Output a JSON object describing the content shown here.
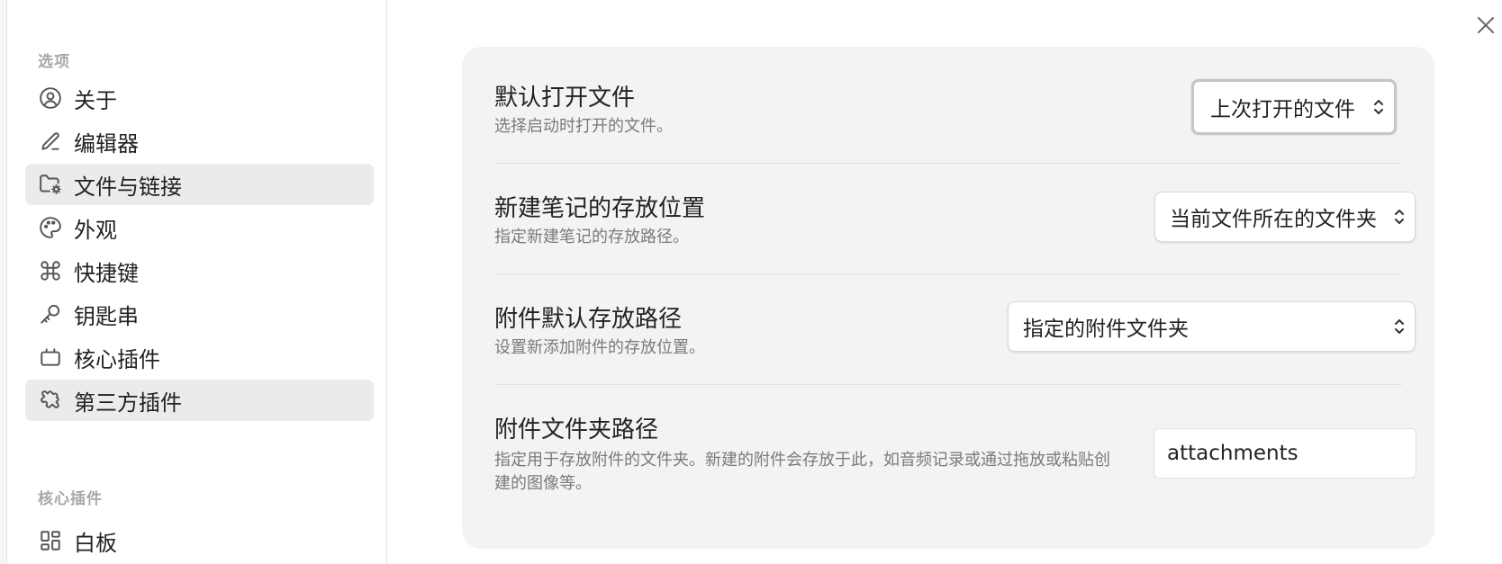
{
  "sidebar": {
    "section_options": "选项",
    "items": [
      {
        "label": "关于",
        "icon": "user-circle-icon",
        "active": false
      },
      {
        "label": "编辑器",
        "icon": "pencil-icon",
        "active": false
      },
      {
        "label": "文件与链接",
        "icon": "folder-cog-icon",
        "active": true
      },
      {
        "label": "外观",
        "icon": "palette-icon",
        "active": false
      },
      {
        "label": "快捷键",
        "icon": "command-icon",
        "active": false
      },
      {
        "label": "钥匙串",
        "icon": "key-icon",
        "active": false
      },
      {
        "label": "核心插件",
        "icon": "plugin-box-icon",
        "active": false
      },
      {
        "label": "第三方插件",
        "icon": "puzzle-icon",
        "active": true
      }
    ],
    "section_core_plugins": "核心插件",
    "core_plugin_items": [
      {
        "label": "白板",
        "icon": "layout-dashboard-icon"
      }
    ]
  },
  "settings": [
    {
      "title": "默认打开文件",
      "description": "选择启动时打开的文件。",
      "control": "select",
      "value": "上次打开的文件"
    },
    {
      "title": "新建笔记的存放位置",
      "description": "指定新建笔记的存放路径。",
      "control": "select",
      "value": "当前文件所在的文件夹"
    },
    {
      "title": "附件默认存放路径",
      "description": "设置新添加附件的存放位置。",
      "control": "select",
      "value": "指定的附件文件夹"
    },
    {
      "title": "附件文件夹路径",
      "description": "指定用于存放附件的文件夹。新建的附件会存放于此，如音频记录或通过拖放或粘贴创建的图像等。",
      "control": "text",
      "value": "attachments"
    }
  ],
  "colors": {
    "panel_bg": "#f3f3f3",
    "active_item_bg": "#ebebeb",
    "muted_text": "#7a7a7a",
    "section_header": "#a8a8a8"
  }
}
